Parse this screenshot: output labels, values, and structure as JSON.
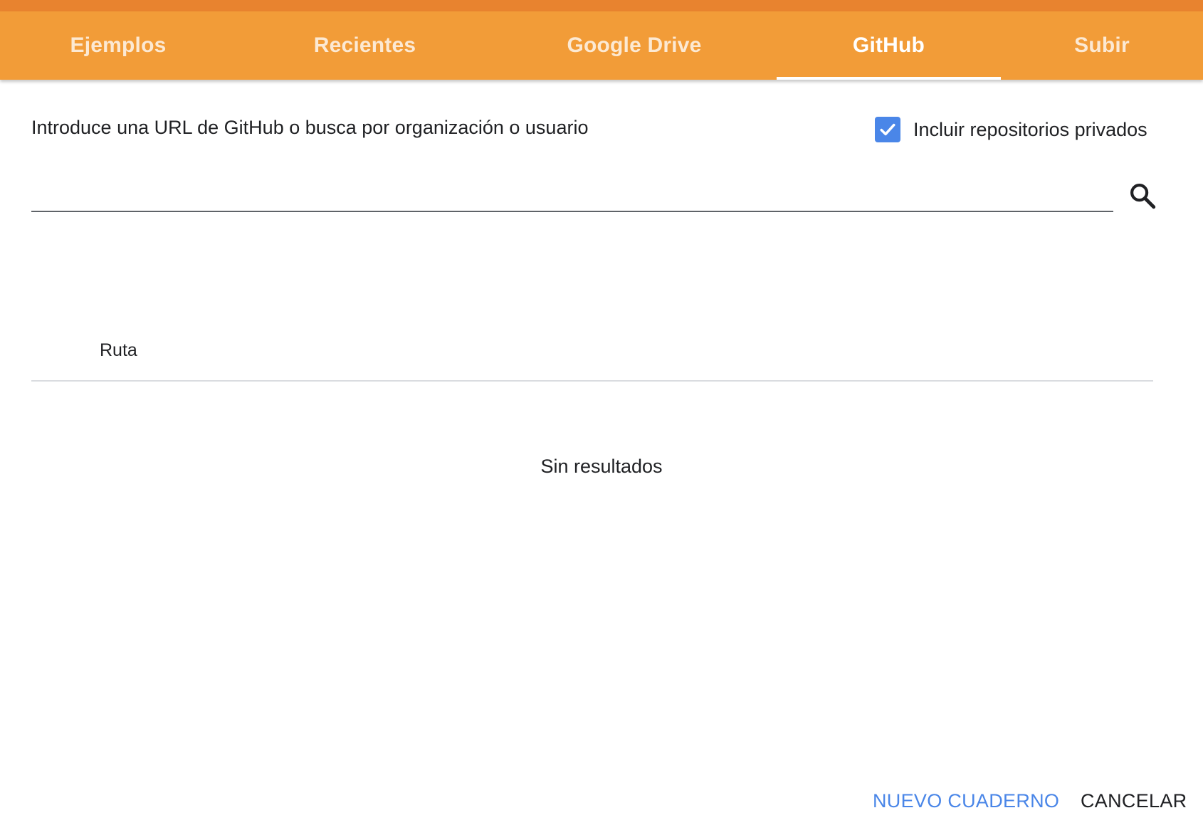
{
  "tabs": [
    {
      "label": "Ejemplos",
      "active": false
    },
    {
      "label": "Recientes",
      "active": false
    },
    {
      "label": "Google Drive",
      "active": false
    },
    {
      "label": "GitHub",
      "active": true
    },
    {
      "label": "Subir",
      "active": false
    }
  ],
  "github": {
    "prompt": "Introduce una URL de GitHub o busca por organización o usuario",
    "include_private_label": "Incluir repositorios privados",
    "include_private_checked": true,
    "search_value": "",
    "search_icon": "search-icon",
    "column_header": "Ruta",
    "empty_message": "Sin resultados"
  },
  "footer": {
    "new_notebook_label": "NUEVO CUADERNO",
    "cancel_label": "CANCELAR"
  },
  "colors": {
    "tabbar": "#f29c38",
    "tabbar_top_strip": "#e8832f",
    "accent_blue": "#4a86e8",
    "text": "#202124"
  }
}
